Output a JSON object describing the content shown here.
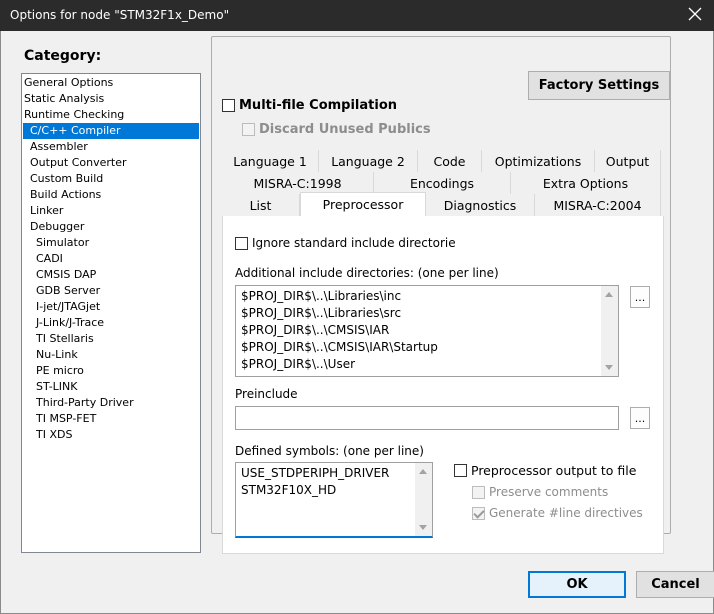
{
  "window": {
    "title": "Options for node \"STM32F1x_Demo\""
  },
  "category": {
    "label": "Category:",
    "items": [
      {
        "label": "General Options",
        "indent": 0,
        "selected": false
      },
      {
        "label": "Static Analysis",
        "indent": 0,
        "selected": false
      },
      {
        "label": "Runtime Checking",
        "indent": 0,
        "selected": false
      },
      {
        "label": "C/C++ Compiler",
        "indent": 1,
        "selected": true
      },
      {
        "label": "Assembler",
        "indent": 1,
        "selected": false
      },
      {
        "label": "Output Converter",
        "indent": 1,
        "selected": false
      },
      {
        "label": "Custom Build",
        "indent": 1,
        "selected": false
      },
      {
        "label": "Build Actions",
        "indent": 1,
        "selected": false
      },
      {
        "label": "Linker",
        "indent": 1,
        "selected": false
      },
      {
        "label": "Debugger",
        "indent": 1,
        "selected": false
      },
      {
        "label": "Simulator",
        "indent": 2,
        "selected": false
      },
      {
        "label": "CADI",
        "indent": 2,
        "selected": false
      },
      {
        "label": "CMSIS DAP",
        "indent": 2,
        "selected": false
      },
      {
        "label": "GDB Server",
        "indent": 2,
        "selected": false
      },
      {
        "label": "I-jet/JTAGjet",
        "indent": 2,
        "selected": false
      },
      {
        "label": "J-Link/J-Trace",
        "indent": 2,
        "selected": false
      },
      {
        "label": "TI Stellaris",
        "indent": 2,
        "selected": false
      },
      {
        "label": "Nu-Link",
        "indent": 2,
        "selected": false
      },
      {
        "label": "PE micro",
        "indent": 2,
        "selected": false
      },
      {
        "label": "ST-LINK",
        "indent": 2,
        "selected": false
      },
      {
        "label": "Third-Party Driver",
        "indent": 2,
        "selected": false
      },
      {
        "label": "TI MSP-FET",
        "indent": 2,
        "selected": false
      },
      {
        "label": "TI XDS",
        "indent": 2,
        "selected": false
      }
    ]
  },
  "panel": {
    "factory_settings": "Factory Settings",
    "multi_file": {
      "label": "Multi-file Compilation",
      "checked": false
    },
    "discard_unused": {
      "label": "Discard Unused Publics",
      "checked": false,
      "disabled": true
    }
  },
  "tabs": {
    "row1": [
      "Language 1",
      "Language 2",
      "Code",
      "Optimizations",
      "Output"
    ],
    "row2": [
      "MISRA-C:1998",
      "Encodings",
      "Extra Options"
    ],
    "row3": [
      "List",
      "Preprocessor",
      "Diagnostics",
      "MISRA-C:2004"
    ],
    "active": "Preprocessor"
  },
  "preprocessor": {
    "ignore_std": {
      "label": "Ignore standard include directories",
      "checked": false
    },
    "include_dirs_label": "Additional include directories: (one per line)",
    "include_dirs": [
      "$PROJ_DIR$\\..\\Libraries\\inc",
      "$PROJ_DIR$\\..\\Libraries\\src",
      "$PROJ_DIR$\\..\\CMSIS\\IAR",
      "$PROJ_DIR$\\..\\CMSIS\\IAR\\Startup",
      "$PROJ_DIR$\\..\\User"
    ],
    "browse_label": "...",
    "preinclude_label": "Preinclude",
    "preinclude_value": "",
    "defined_symbols_label": "Defined symbols: (one per line)",
    "defined_symbols": [
      "USE_STDPERIPH_DRIVER",
      "STM32F10X_HD"
    ],
    "pp_output": {
      "label": "Preprocessor output to file",
      "checked": false
    },
    "preserve_comments": {
      "label": "Preserve comments",
      "checked": false,
      "disabled": true
    },
    "generate_line": {
      "label": "Generate #line directives",
      "checked": true,
      "disabled": true
    }
  },
  "footer": {
    "ok": "OK",
    "cancel": "Cancel"
  },
  "colors": {
    "selection": "#0078d7",
    "titlebar": "#2b2b2b"
  }
}
